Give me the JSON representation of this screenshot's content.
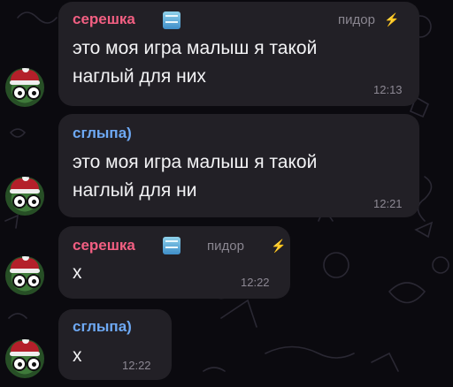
{
  "messages": [
    {
      "sender": "серешка",
      "sender_color": "#f25f82",
      "title": "пидор",
      "title_icon": "lightning-bolt-icon",
      "badge_icon": "ice-cube-emoji-icon",
      "lines": [
        "это моя игра малыш я такой",
        "наглый для них"
      ],
      "time": "12:13"
    },
    {
      "sender": "сглыпа)",
      "sender_color": "#6ea9f4",
      "lines": [
        "это моя игра малыш я такой",
        "наглый для ни"
      ],
      "time": "12:21"
    },
    {
      "sender": "серешка",
      "sender_color": "#f25f82",
      "title": "пидор",
      "title_icon": "lightning-bolt-icon",
      "badge_icon": "ice-cube-emoji-icon",
      "lines": [
        "х"
      ],
      "time": "12:22"
    },
    {
      "sender": "сглыпа)",
      "sender_color": "#6ea9f4",
      "lines": [
        "х"
      ],
      "time": "12:22"
    }
  ],
  "bolt_glyph": "⚡",
  "bubble_color": "#222026",
  "background_color": "#0b0a0f"
}
